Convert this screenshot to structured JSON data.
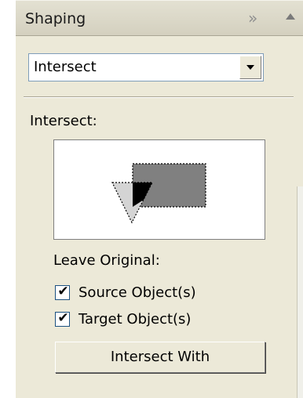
{
  "panel": {
    "title": "Shaping",
    "expand_icon": "double-chevron-right-icon",
    "collapse_icon": "triangle-up-icon"
  },
  "operation_select": {
    "value": "Intersect"
  },
  "section": {
    "label": "Intersect:"
  },
  "leave_original": {
    "label": "Leave Original:",
    "options": [
      {
        "label": "Source Object(s)",
        "checked": true
      },
      {
        "label": "Target Object(s)",
        "checked": true
      }
    ]
  },
  "action_button": {
    "label": "Intersect With"
  },
  "colors": {
    "panel_bg": "#ece9d8",
    "preview_rect": "#808080",
    "preview_triangle": "#d4d4d4",
    "preview_intersection": "#000000"
  }
}
